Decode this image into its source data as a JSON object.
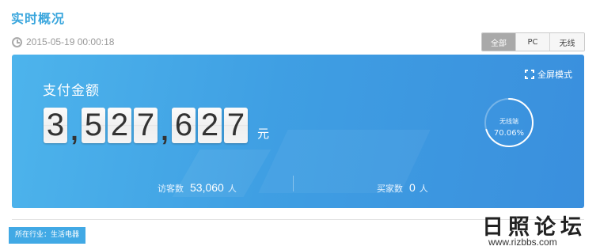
{
  "page": {
    "title": "实时概况"
  },
  "timestamp": {
    "text": "2015-05-19 00:00:18"
  },
  "tabs": [
    {
      "label": "全部",
      "active": true
    },
    {
      "label": "PC",
      "active": false
    },
    {
      "label": "无线",
      "active": false
    }
  ],
  "panel": {
    "label": "支付金额",
    "amount_digits": [
      "3",
      ",",
      "5",
      "2",
      "7",
      ",",
      "6",
      "2",
      "7"
    ],
    "unit": "元",
    "fullscreen_label": "全屏模式",
    "ring": {
      "label": "无线端",
      "value_text": "70.06%",
      "fraction": 0.7006
    },
    "stats": {
      "visitors": {
        "label": "访客数",
        "value": "53,060",
        "unit": "人"
      },
      "buyers": {
        "label": "买家数",
        "value": "0",
        "unit": "人"
      }
    },
    "colors": {
      "gradient_start": "#4db4ec",
      "gradient_end": "#3a8fdd",
      "ring_track": "rgba(255,255,255,0.3)",
      "ring_fill": "#ffffff"
    }
  },
  "industry": {
    "label": "所在行业：生活电器"
  },
  "watermark": {
    "logo": "日照论坛",
    "url": "www.rizbbs.com"
  },
  "icons": {
    "clock": "clock-icon",
    "fullscreen": "fullscreen-icon"
  }
}
